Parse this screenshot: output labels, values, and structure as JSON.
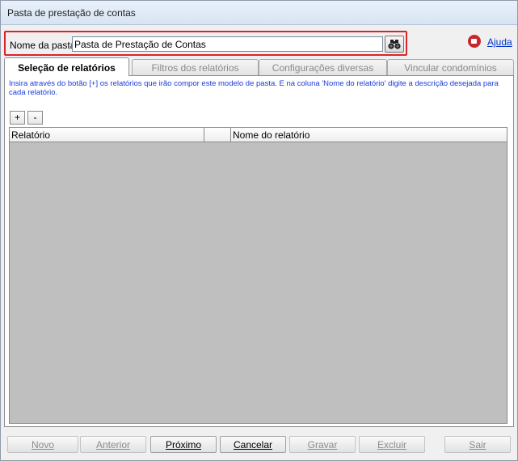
{
  "window": {
    "title": "Pasta de prestação de contas"
  },
  "name_bar": {
    "label": "Nome da pasta:",
    "value": "Pasta de Prestação de Contas",
    "search_icon": "binoculars-icon"
  },
  "help": {
    "icon": "help-record-icon",
    "label": "Ajuda"
  },
  "tabs": [
    {
      "label": "Seleção de relatórios",
      "active": true
    },
    {
      "label": "Filtros dos relatórios",
      "active": false
    },
    {
      "label": "Configurações diversas",
      "active": false
    },
    {
      "label": "Vincular condomínios",
      "active": false
    }
  ],
  "panel": {
    "instructions": "Insira através do botão [+] os relatórios que irão compor este modelo de pasta. E na coluna 'Nome do relatório' digite a descrição desejada para cada relatório.",
    "add_label": "+",
    "remove_label": "-"
  },
  "grid": {
    "columns": [
      "Relatório",
      "",
      "Nome do relatório"
    ],
    "rows": []
  },
  "buttons": [
    {
      "label": "Novo",
      "enabled": false
    },
    {
      "label": "Anterior",
      "enabled": false
    },
    {
      "label": "Próximo",
      "enabled": true
    },
    {
      "label": "Cancelar",
      "enabled": true
    },
    {
      "label": "Gravar",
      "enabled": false
    },
    {
      "label": "Excluir",
      "enabled": false
    },
    {
      "label": "Sair",
      "enabled": false
    }
  ],
  "colors": {
    "highlight_border": "#d9252a",
    "link": "#0033cc",
    "instruction_text": "#1a3bd6"
  }
}
